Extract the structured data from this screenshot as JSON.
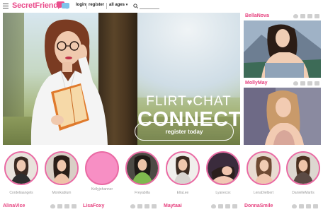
{
  "header": {
    "logo_text": "SecretFriends",
    "nav": {
      "login": "login",
      "register": "register",
      "all_ages": "all ages"
    },
    "search_placeholder": ""
  },
  "hero": {
    "line1a": "FLIRT",
    "heart": "♥",
    "line1b": "CHAT",
    "line2": "CONNECT",
    "cta": "register today"
  },
  "side_cards": [
    {
      "name": "BellaNova"
    },
    {
      "name": "MollyMay"
    }
  ],
  "avatars": [
    {
      "name": "Cordeliaangels"
    },
    {
      "name": "Monikablum"
    },
    {
      "name": "Kellyjohanner"
    },
    {
      "name": "Freyabilla"
    },
    {
      "name": "EllaLee"
    },
    {
      "name": "Lyanecox"
    },
    {
      "name": "LenaDielbert"
    },
    {
      "name": "DanielleMarlis"
    }
  ],
  "bottom_row": [
    {
      "name": "AlinaVice"
    },
    {
      "name": "LisaFoxy"
    },
    {
      "name": "Maytaai"
    },
    {
      "name": "DonnaSmile"
    }
  ],
  "colors": {
    "brand_pink": "#e6407e",
    "ring_pink": "#ea6aa4"
  }
}
